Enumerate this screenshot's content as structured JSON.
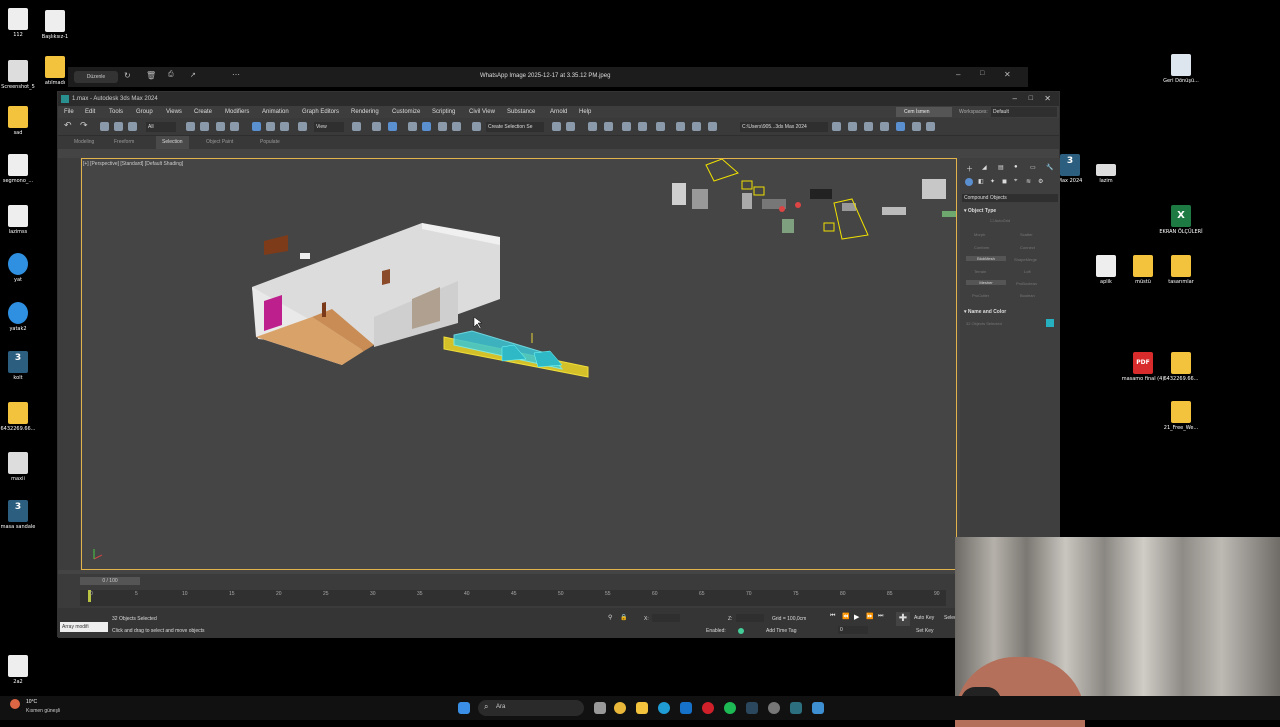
{
  "desktop": {
    "icons": [
      {
        "label": "112"
      },
      {
        "label": "Başlıksız-1"
      },
      {
        "label": "Screenshot_5"
      },
      {
        "label": "atılmadı"
      },
      {
        "label": "sad"
      },
      {
        "label": "segmono_..."
      },
      {
        "label": "lazimss"
      },
      {
        "label": "yat"
      },
      {
        "label": "yatak2"
      },
      {
        "label": "kolt"
      },
      {
        "label": "6432269.66..."
      },
      {
        "label": "maxii"
      },
      {
        "label": "masa sandale"
      },
      {
        "label": "2a2"
      },
      {
        "label": "Geri Dönüşü..."
      },
      {
        "label": "Max 2024"
      },
      {
        "label": "lazim"
      },
      {
        "label": "EKRAN ÖLÇÜLERİ"
      },
      {
        "label": "aplik"
      },
      {
        "label": "müstü"
      },
      {
        "label": "tasarımlar"
      },
      {
        "label": "masamo final (4)"
      },
      {
        "label": "6432269.66..."
      },
      {
        "label": "21_Free_We..."
      }
    ],
    "glyph_text": {
      "max": "3",
      "pdf": "PDF",
      "excel": "X"
    }
  },
  "viewer": {
    "title": "WhatsApp Image 2025-12-17 at 3.35.12 PM.jpeg",
    "edit_label": "Düzenle"
  },
  "max": {
    "title": "1.max - Autodesk 3ds Max 2024",
    "menu": [
      "File",
      "Edit",
      "Tools",
      "Group",
      "Views",
      "Create",
      "Modifiers",
      "Animation",
      "Graph Editors",
      "Rendering",
      "Customize",
      "Scripting",
      "Civil View",
      "Substance",
      "Arnold",
      "Help"
    ],
    "user": "Cem İsmen",
    "workspaces_label": "Workspaces:",
    "workspace_value": "Default",
    "selection_set": "Create Selection Se",
    "path": "C:\\Users\\905...3ds Max 2024",
    "view_dropdown": "View",
    "all_dropdown": "All",
    "ribbon_tabs": [
      "Modeling",
      "Freeform",
      "Selection",
      "Object Paint",
      "Populate"
    ],
    "viewport_label": "[+] [Perspective] [Standard] [Default Shading]",
    "cmd": {
      "category": "Compound Objects",
      "object_type": "Object Type",
      "autogrid": "AutoGrid",
      "buttons": [
        "Morph",
        "Scatter",
        "Conform",
        "Connect",
        "BlobMesh",
        "ShapeMerge",
        "Terrain",
        "Loft",
        "Mesher",
        "ProBoolean",
        "ProCutter",
        "Boolean"
      ],
      "name_color": "Name and Color",
      "name_value": "32 Objects Selected",
      "name_color_swatch": "#27b0c0"
    },
    "timeline": {
      "frame_label": "0 / 100",
      "ticks": [
        "0",
        "5",
        "10",
        "15",
        "20",
        "25",
        "30",
        "35",
        "40",
        "45",
        "50",
        "55",
        "60",
        "65",
        "70",
        "75",
        "80",
        "85",
        "90"
      ]
    },
    "status": {
      "selected": "32 Objects Selected",
      "hint": "Click and drag to select and move objects",
      "script_box": "Array modifi",
      "x_label": "X:",
      "z_label": "Z:",
      "grid": "Grid = 100,0cm",
      "enabled": "Enabled:",
      "add_time_tag": "Add Time Tag",
      "auto_key": "Auto Key",
      "selected_btn": "Selec",
      "set_key": "Set Key",
      "key_filters": "0"
    }
  },
  "taskbar": {
    "weather_temp": "10°C",
    "weather_text": "Kısmen güneşli",
    "search": "Ara"
  }
}
